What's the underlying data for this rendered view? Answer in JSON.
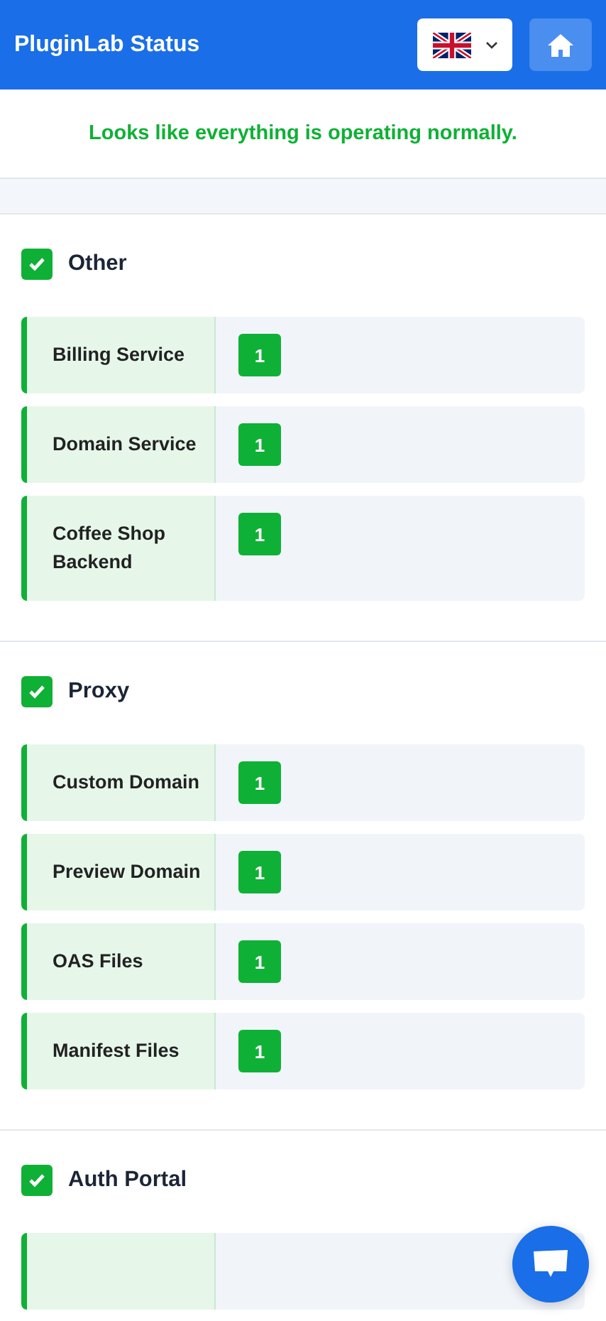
{
  "header": {
    "title": "PluginLab Status"
  },
  "banner": {
    "message": "Looks like everything is operating normally.",
    "operational": true
  },
  "sections": [
    {
      "name": "Other",
      "operational": true,
      "rows": [
        {
          "name": "Billing Service",
          "operational": true,
          "count": "1"
        },
        {
          "name": "Domain Service",
          "operational": true,
          "count": "1"
        },
        {
          "name": "Coffee Shop Backend",
          "operational": true,
          "count": "1"
        }
      ]
    },
    {
      "name": "Proxy",
      "operational": true,
      "rows": [
        {
          "name": "Custom Domain",
          "operational": true,
          "count": "1"
        },
        {
          "name": "Preview Domain",
          "operational": true,
          "count": "1"
        },
        {
          "name": "OAS Files",
          "operational": true,
          "count": "1"
        },
        {
          "name": "Manifest Files",
          "operational": true,
          "count": "1"
        }
      ]
    },
    {
      "name": "Auth Portal",
      "operational": true,
      "more_rows_below": true
    }
  ]
}
